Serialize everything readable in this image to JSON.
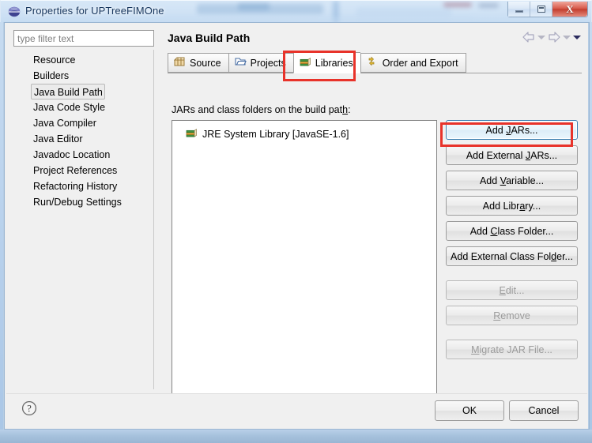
{
  "window": {
    "title": "Properties for UPTreeFIMOne",
    "icon": "eclipse-globe-icon",
    "caption_buttons": {
      "minimize": "minimize-icon",
      "maximize": "maximize-icon",
      "close": "X"
    }
  },
  "sidebar": {
    "filter": {
      "placeholder": "type filter text",
      "value": ""
    },
    "items": [
      {
        "label": "Resource",
        "selected": false
      },
      {
        "label": "Builders",
        "selected": false
      },
      {
        "label": "Java Build Path",
        "selected": true
      },
      {
        "label": "Java Code Style",
        "selected": false
      },
      {
        "label": "Java Compiler",
        "selected": false
      },
      {
        "label": "Java Editor",
        "selected": false
      },
      {
        "label": "Javadoc Location",
        "selected": false
      },
      {
        "label": "Project References",
        "selected": false
      },
      {
        "label": "Refactoring History",
        "selected": false
      },
      {
        "label": "Run/Debug Settings",
        "selected": false
      }
    ]
  },
  "page": {
    "title": "Java Build Path",
    "nav": {
      "back": "back-arrow-icon",
      "back_menu": "chevron-down-icon",
      "forward": "forward-arrow-icon",
      "forward_menu": "chevron-down-icon",
      "view_menu": "chevron-down-icon"
    },
    "tabs": [
      {
        "label": "Source",
        "icon": "package-icon",
        "active": false
      },
      {
        "label": "Projects",
        "icon": "folder-open-icon",
        "active": false
      },
      {
        "label": "Libraries",
        "icon": "books-icon",
        "active": true
      },
      {
        "label": "Order and Export",
        "icon": "order-arrows-icon",
        "active": false
      }
    ],
    "list_label_pre": "JARs and class folders on the build pat",
    "list_label_mnemonic": "h",
    "list_label_post": ":",
    "entries": [
      {
        "label": "JRE System Library [JavaSE-1.6]",
        "icon": "books-icon"
      }
    ],
    "buttons": [
      {
        "pre": "Add ",
        "mnemonic": "J",
        "post": "ARs...",
        "state": "focused"
      },
      {
        "pre": "Add External ",
        "mnemonic": "J",
        "post": "ARs...",
        "state": "normal"
      },
      {
        "pre": "Add ",
        "mnemonic": "V",
        "post": "ariable...",
        "state": "normal"
      },
      {
        "pre": "Add Libr",
        "mnemonic": "a",
        "post": "ry...",
        "state": "normal"
      },
      {
        "pre": "Add ",
        "mnemonic": "C",
        "post": "lass Folder...",
        "state": "normal"
      },
      {
        "pre": "Add External Class Fol",
        "mnemonic": "d",
        "post": "er...",
        "state": "normal"
      },
      {
        "pre": "",
        "mnemonic": "E",
        "post": "dit...",
        "state": "disabled"
      },
      {
        "pre": "",
        "mnemonic": "R",
        "post": "emove",
        "state": "disabled"
      },
      {
        "pre": "",
        "mnemonic": "M",
        "post": "igrate JAR File...",
        "state": "disabled"
      }
    ]
  },
  "annotations": {
    "accent_color": "#e8332a",
    "highlighted": [
      "Libraries",
      "Add External JARs..."
    ]
  },
  "footer": {
    "help": "help-icon",
    "ok_label": "OK",
    "cancel_label": "Cancel"
  }
}
